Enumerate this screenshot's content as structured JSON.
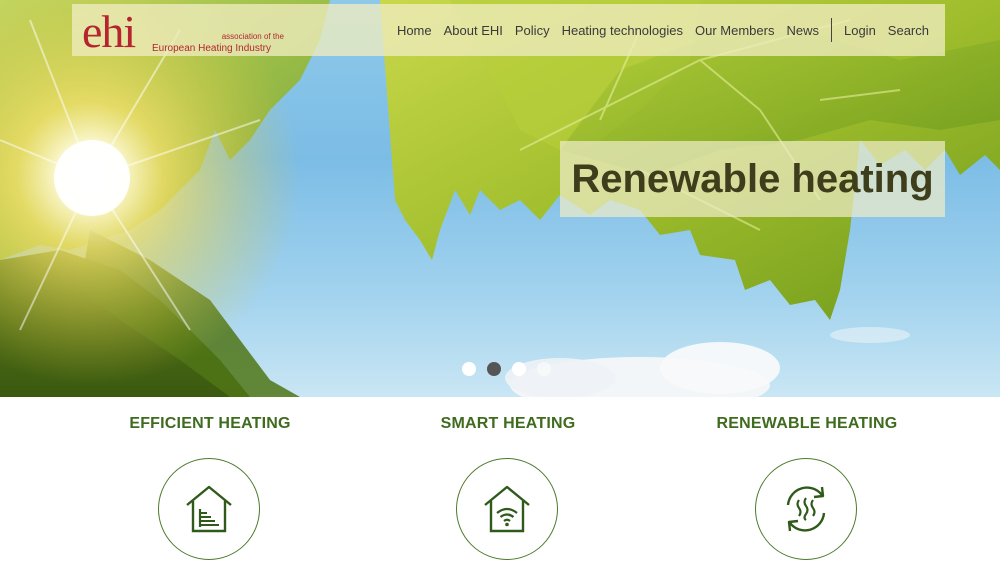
{
  "logo": {
    "main": "ehi",
    "line1": "association of the",
    "line2": "European Heating Industry"
  },
  "nav": {
    "items": [
      "Home",
      "About EHI",
      "Policy",
      "Heating technologies",
      "Our Members",
      "News"
    ],
    "login": "Login",
    "search": "Search"
  },
  "hero": {
    "caption": "Renewable heating",
    "slides": 4,
    "active_slide": 2
  },
  "features": [
    {
      "title": "EFFICIENT HEATING",
      "icon": "house-efficiency-icon"
    },
    {
      "title": "SMART HEATING",
      "icon": "house-wifi-icon"
    },
    {
      "title": "RENEWABLE HEATING",
      "icon": "renewable-cycle-icon"
    }
  ],
  "colors": {
    "logo_red": "#b5252f",
    "heading_green": "#3f6b1f",
    "icon_green": "#2f5a1a"
  }
}
